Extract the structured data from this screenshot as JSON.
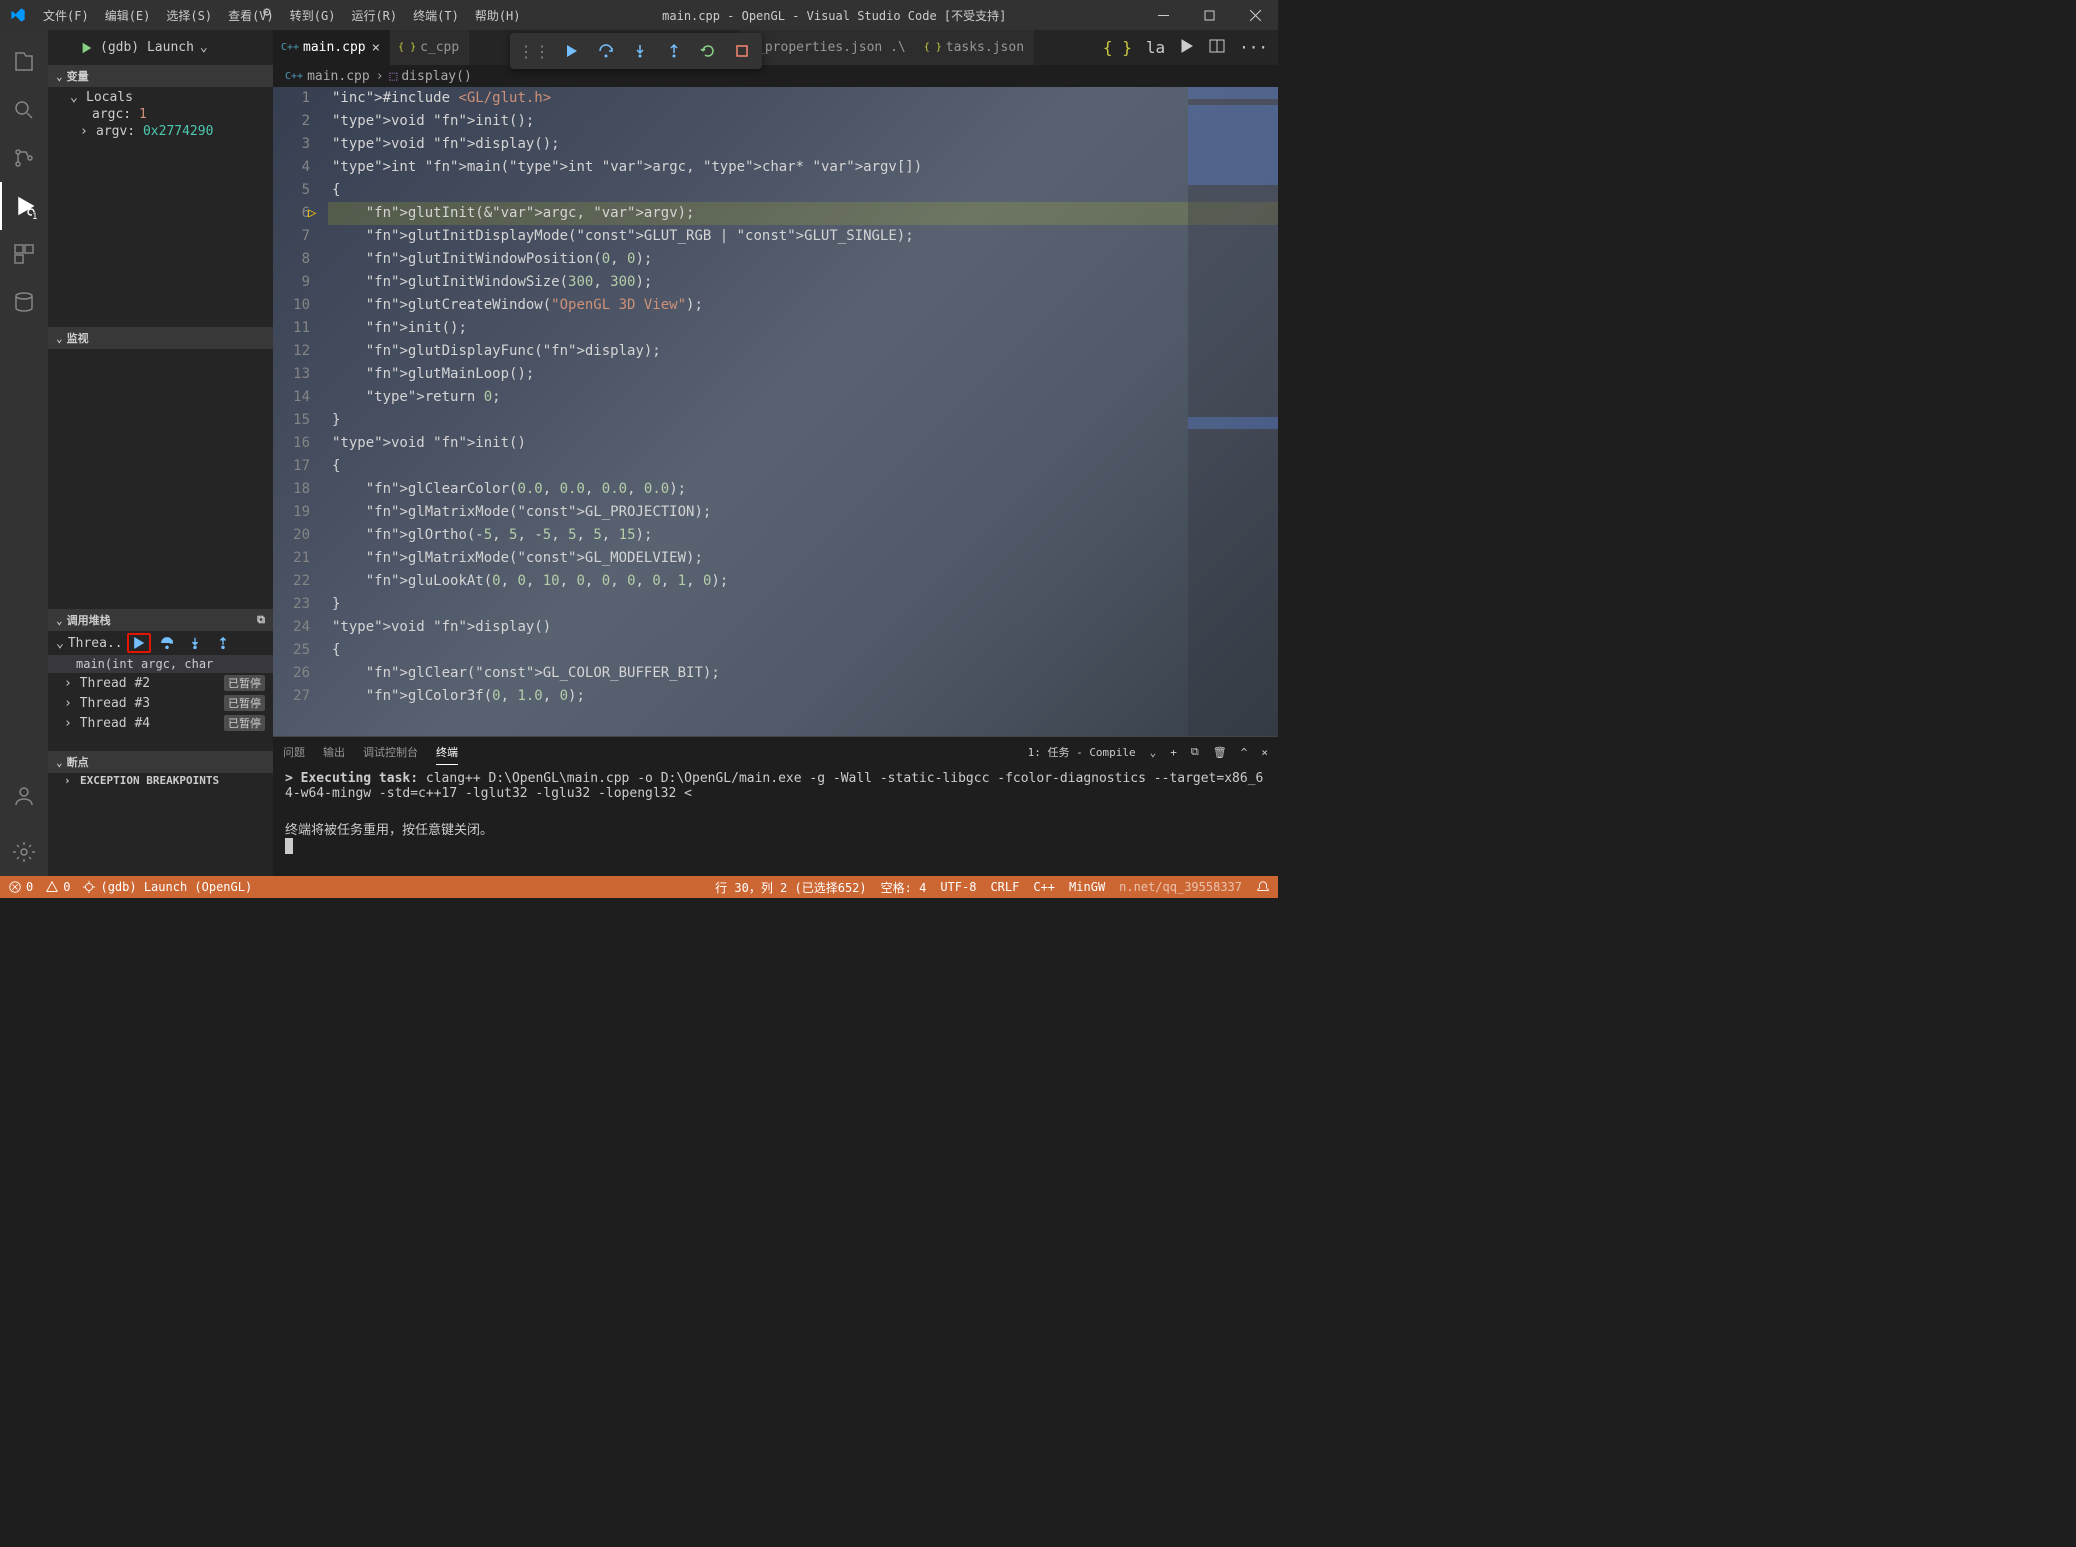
{
  "titlebar": {
    "title": "main.cpp - OpenGL - Visual Studio Code [不受支持]",
    "menu": [
      "文件(F)",
      "编辑(E)",
      "选择(S)",
      "查看(V)",
      "转到(G)",
      "运行(R)",
      "终端(T)",
      "帮助(H)"
    ]
  },
  "run_config": "(gdb) Launch",
  "tabs": [
    {
      "label": "main.cpp",
      "active": true
    },
    {
      "label": "c_cpp",
      "active": false
    },
    {
      "label": "p_properties.json .\\",
      "active": false
    },
    {
      "label": "tasks.json",
      "active": false
    },
    {
      "label": "la",
      "active": false
    }
  ],
  "breadcrumb": {
    "file": "main.cpp",
    "symbol": "display()"
  },
  "activity_badge": "1",
  "sidebar": {
    "variables_title": "变量",
    "locals": "Locals",
    "vars": [
      {
        "name": "argc:",
        "value": "1"
      },
      {
        "name": "argv:",
        "value": "0x2774290"
      }
    ],
    "watch_title": "监视",
    "callstack_title": "调用堆栈",
    "thread_label": "Threa..",
    "frame": "main(int argc, char",
    "threads": [
      {
        "name": "Thread #2",
        "status": "已暂停"
      },
      {
        "name": "Thread #3",
        "status": "已暂停"
      },
      {
        "name": "Thread #4",
        "status": "已暂停"
      }
    ],
    "breakpoints_title": "断点",
    "exception_bp": "EXCEPTION BREAKPOINTS"
  },
  "code": {
    "lines": [
      {
        "n": 1,
        "html": "#include <GL/glut.h>"
      },
      {
        "n": 2,
        "html": "void init();"
      },
      {
        "n": 3,
        "html": "void display();"
      },
      {
        "n": 4,
        "html": "int main(int argc, char* argv[])"
      },
      {
        "n": 5,
        "html": "{"
      },
      {
        "n": 6,
        "html": "    glutInit(&argc, argv);"
      },
      {
        "n": 7,
        "html": "    glutInitDisplayMode(GLUT_RGB | GLUT_SINGLE);"
      },
      {
        "n": 8,
        "html": "    glutInitWindowPosition(0, 0);"
      },
      {
        "n": 9,
        "html": "    glutInitWindowSize(300, 300);"
      },
      {
        "n": 10,
        "html": "    glutCreateWindow(\"OpenGL 3D View\");"
      },
      {
        "n": 11,
        "html": "    init();"
      },
      {
        "n": 12,
        "html": "    glutDisplayFunc(display);"
      },
      {
        "n": 13,
        "html": "    glutMainLoop();"
      },
      {
        "n": 14,
        "html": "    return 0;"
      },
      {
        "n": 15,
        "html": "}"
      },
      {
        "n": 16,
        "html": "void init()"
      },
      {
        "n": 17,
        "html": "{"
      },
      {
        "n": 18,
        "html": "    glClearColor(0.0, 0.0, 0.0, 0.0);"
      },
      {
        "n": 19,
        "html": "    glMatrixMode(GL_PROJECTION);"
      },
      {
        "n": 20,
        "html": "    glOrtho(-5, 5, -5, 5, 5, 15);"
      },
      {
        "n": 21,
        "html": "    glMatrixMode(GL_MODELVIEW);"
      },
      {
        "n": 22,
        "html": "    gluLookAt(0, 0, 10, 0, 0, 0, 0, 1, 0);"
      },
      {
        "n": 23,
        "html": "}"
      },
      {
        "n": 24,
        "html": "void display()"
      },
      {
        "n": 25,
        "html": "{"
      },
      {
        "n": 26,
        "html": "    glClear(GL_COLOR_BUFFER_BIT);"
      },
      {
        "n": 27,
        "html": "    glColor3f(0, 1.0, 0);"
      }
    ]
  },
  "panel": {
    "tabs": [
      "问题",
      "输出",
      "调试控制台",
      "终端"
    ],
    "active_tab": "终端",
    "task_dropdown": "1: 任务 - Compile",
    "exec_prefix": "> Executing task: ",
    "command": "clang++ D:\\OpenGL\\main.cpp -o D:\\OpenGL/main.exe -g -Wall -static-libgcc -fcolor-diagnostics --target=x86_64-w64-mingw -std=c++17 -lglut32 -lglu32 -lopengl32 <",
    "close_note": "终端将被任务重用，按任意键关闭。"
  },
  "statusbar": {
    "errors": "0",
    "warnings": "0",
    "debug_target": "(gdb) Launch (OpenGL)",
    "cursor": "行 30，列 2 (已选择652)",
    "spaces": "空格: 4",
    "encoding": "UTF-8",
    "eol": "CRLF",
    "lang": "C++",
    "compiler": "MinGW",
    "watermark": "n.net/qq_39558337"
  }
}
